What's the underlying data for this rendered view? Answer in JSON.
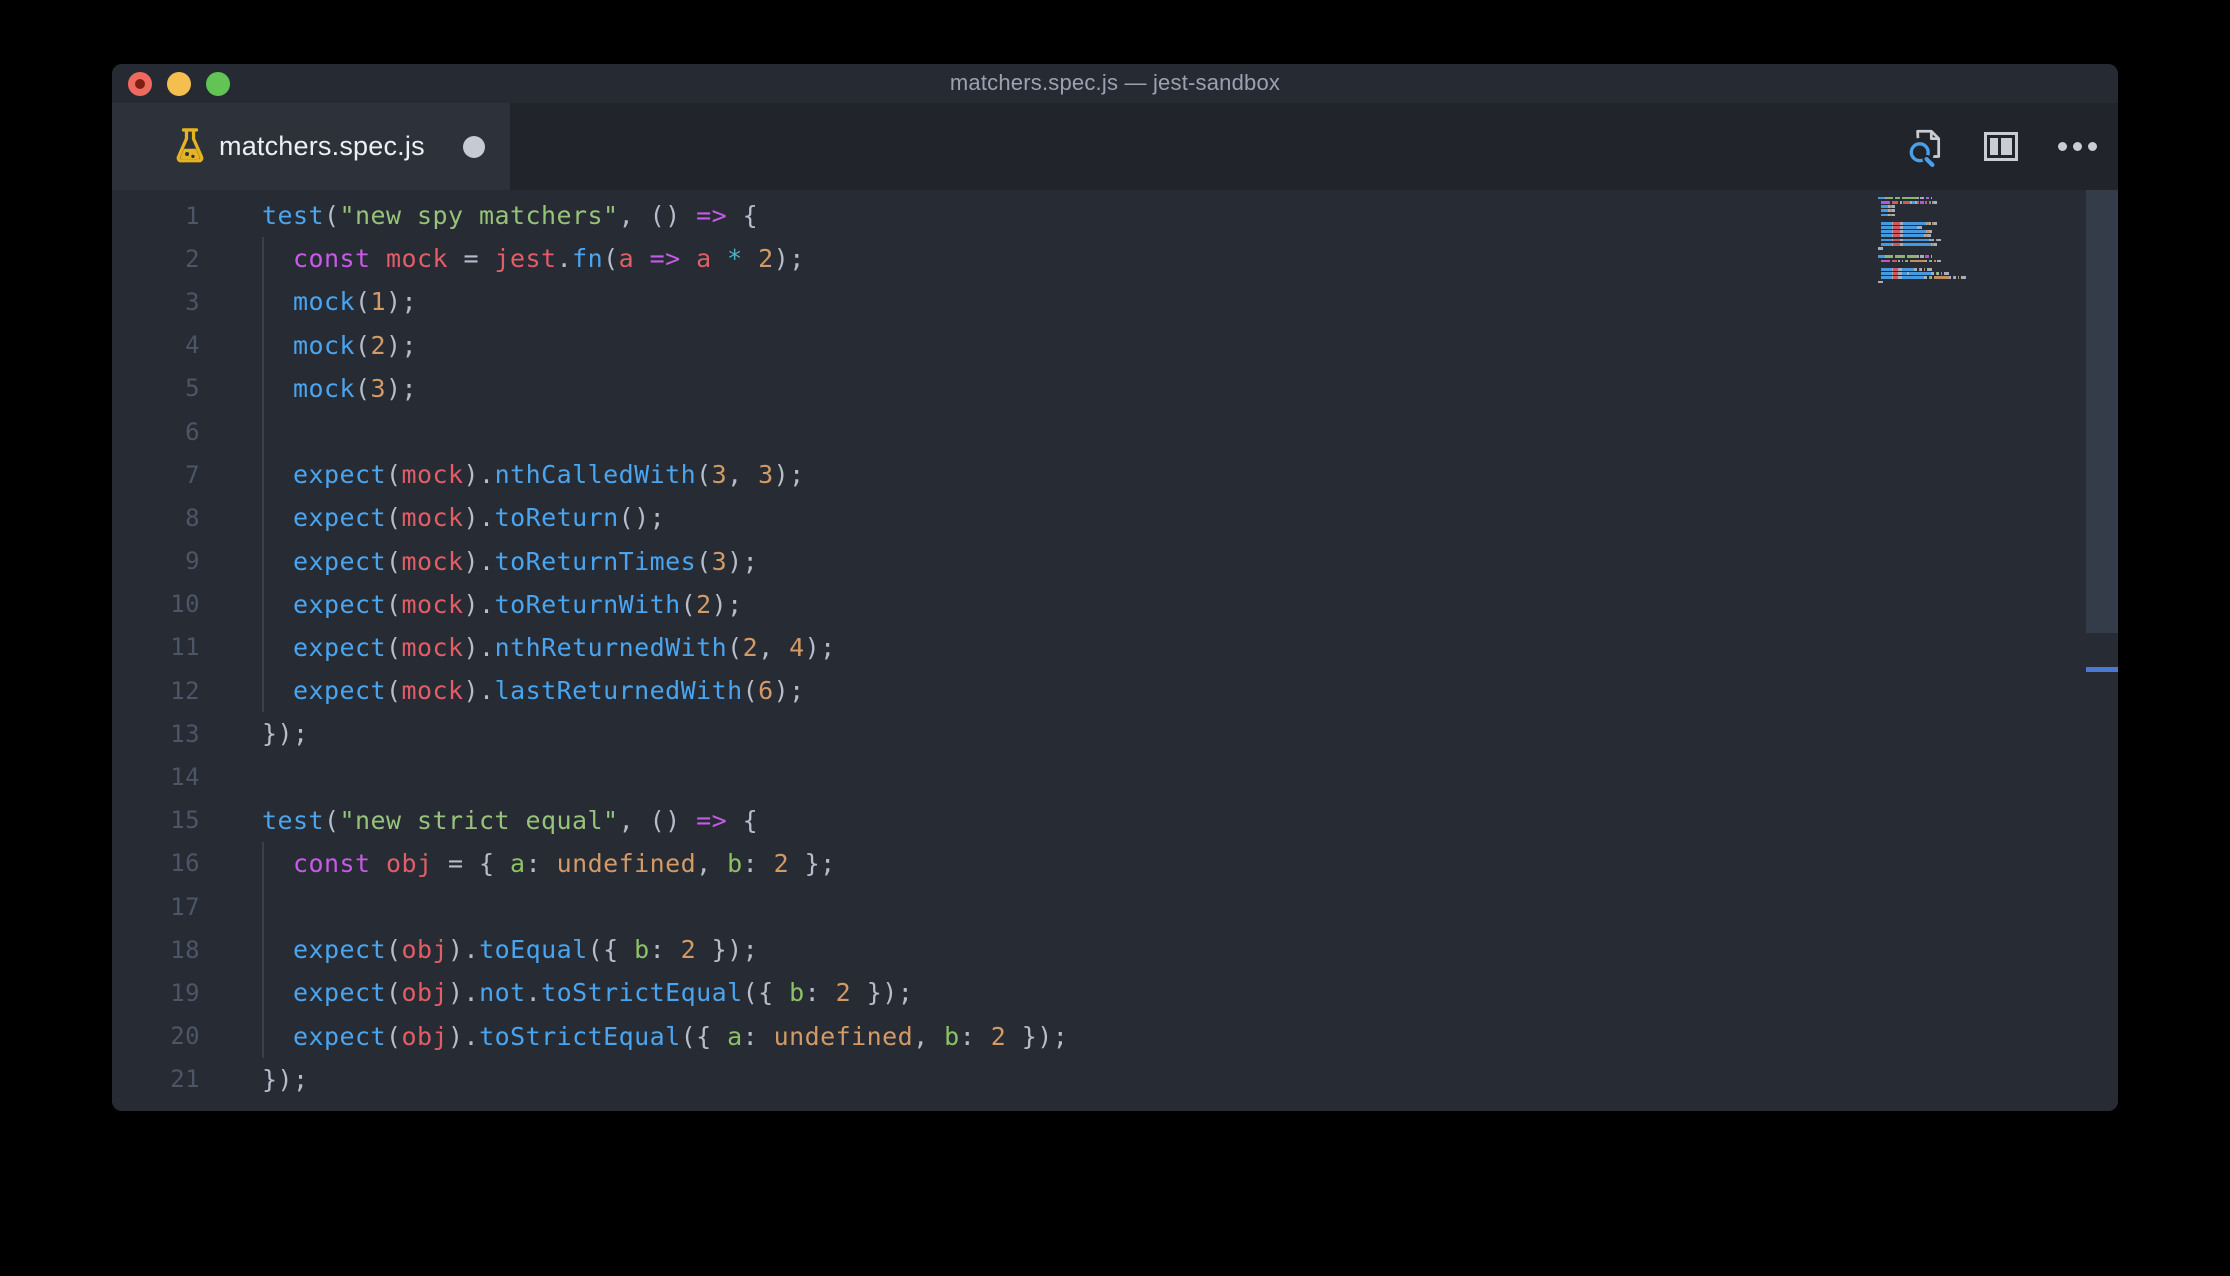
{
  "window": {
    "title": "matchers.spec.js — jest-sandbox"
  },
  "tab": {
    "label": "matchers.spec.js",
    "modified": true,
    "icon": "test-flask-icon"
  },
  "toolbar": {
    "icons": [
      "search-file-icon",
      "split-editor-icon",
      "more-actions-icon"
    ]
  },
  "colors": {
    "desktop": "#000000",
    "titlebar": "#262b33",
    "tabbar": "#21252b",
    "active_tab": "#2c313a",
    "editor_bg": "#272b33",
    "traffic_red": "#ee6a5f",
    "traffic_yellow": "#f5bf50",
    "traffic_green": "#61c455",
    "line_number": "#4d5666",
    "scroll_thumb": "#343b49",
    "overview_cursor": "#4b78d4",
    "icon_gray": "#c9ccd1",
    "icon_blue": "#4aa0e8",
    "flask_yellow": "#e6b322"
  },
  "editor": {
    "syntax": {
      "fn": "#4aa5f0",
      "kw": "#c75ae8",
      "s": "#97c279",
      "n": "#d19a66",
      "v": "#e25d67",
      "cy": "#4cb2c4",
      "p": "#b6bdca",
      "k": "#8cc265"
    },
    "lines": [
      {
        "n": 1,
        "i": 0,
        "g": false,
        "t": [
          [
            "fn",
            "test"
          ],
          [
            "p",
            "("
          ],
          [
            "s",
            "\"new spy matchers\""
          ],
          [
            "p",
            ", () "
          ],
          [
            "kw",
            "=>"
          ],
          [
            "p",
            " {"
          ]
        ]
      },
      {
        "n": 2,
        "i": 1,
        "g": true,
        "t": [
          [
            "kw",
            "const "
          ],
          [
            "v",
            "mock"
          ],
          [
            "p",
            " = "
          ],
          [
            "v",
            "jest"
          ],
          [
            "p",
            "."
          ],
          [
            "fn",
            "fn"
          ],
          [
            "p",
            "("
          ],
          [
            "v",
            "a"
          ],
          [
            "kw",
            " => "
          ],
          [
            "v",
            "a"
          ],
          [
            "cy",
            " * "
          ],
          [
            "n",
            "2"
          ],
          [
            "p",
            ");"
          ]
        ]
      },
      {
        "n": 3,
        "i": 1,
        "g": true,
        "t": [
          [
            "fn",
            "mock"
          ],
          [
            "p",
            "("
          ],
          [
            "n",
            "1"
          ],
          [
            "p",
            ");"
          ]
        ]
      },
      {
        "n": 4,
        "i": 1,
        "g": true,
        "t": [
          [
            "fn",
            "mock"
          ],
          [
            "p",
            "("
          ],
          [
            "n",
            "2"
          ],
          [
            "p",
            ");"
          ]
        ]
      },
      {
        "n": 5,
        "i": 1,
        "g": true,
        "t": [
          [
            "fn",
            "mock"
          ],
          [
            "p",
            "("
          ],
          [
            "n",
            "3"
          ],
          [
            "p",
            ");"
          ]
        ]
      },
      {
        "n": 6,
        "i": 0,
        "g": true,
        "t": []
      },
      {
        "n": 7,
        "i": 1,
        "g": true,
        "t": [
          [
            "fn",
            "expect"
          ],
          [
            "p",
            "("
          ],
          [
            "v",
            "mock"
          ],
          [
            "p",
            ")."
          ],
          [
            "fn",
            "nthCalledWith"
          ],
          [
            "p",
            "("
          ],
          [
            "n",
            "3"
          ],
          [
            "p",
            ", "
          ],
          [
            "n",
            "3"
          ],
          [
            "p",
            ");"
          ]
        ]
      },
      {
        "n": 8,
        "i": 1,
        "g": true,
        "t": [
          [
            "fn",
            "expect"
          ],
          [
            "p",
            "("
          ],
          [
            "v",
            "mock"
          ],
          [
            "p",
            ")."
          ],
          [
            "fn",
            "toReturn"
          ],
          [
            "p",
            "();"
          ]
        ]
      },
      {
        "n": 9,
        "i": 1,
        "g": true,
        "t": [
          [
            "fn",
            "expect"
          ],
          [
            "p",
            "("
          ],
          [
            "v",
            "mock"
          ],
          [
            "p",
            ")."
          ],
          [
            "fn",
            "toReturnTimes"
          ],
          [
            "p",
            "("
          ],
          [
            "n",
            "3"
          ],
          [
            "p",
            ");"
          ]
        ]
      },
      {
        "n": 10,
        "i": 1,
        "g": true,
        "t": [
          [
            "fn",
            "expect"
          ],
          [
            "p",
            "("
          ],
          [
            "v",
            "mock"
          ],
          [
            "p",
            ")."
          ],
          [
            "fn",
            "toReturnWith"
          ],
          [
            "p",
            "("
          ],
          [
            "n",
            "2"
          ],
          [
            "p",
            ");"
          ]
        ]
      },
      {
        "n": 11,
        "i": 1,
        "g": true,
        "t": [
          [
            "fn",
            "expect"
          ],
          [
            "p",
            "("
          ],
          [
            "v",
            "mock"
          ],
          [
            "p",
            ")."
          ],
          [
            "fn",
            "nthReturnedWith"
          ],
          [
            "p",
            "("
          ],
          [
            "n",
            "2"
          ],
          [
            "p",
            ", "
          ],
          [
            "n",
            "4"
          ],
          [
            "p",
            ");"
          ]
        ]
      },
      {
        "n": 12,
        "i": 1,
        "g": true,
        "t": [
          [
            "fn",
            "expect"
          ],
          [
            "p",
            "("
          ],
          [
            "v",
            "mock"
          ],
          [
            "p",
            ")."
          ],
          [
            "fn",
            "lastReturnedWith"
          ],
          [
            "p",
            "("
          ],
          [
            "n",
            "6"
          ],
          [
            "p",
            ");"
          ]
        ]
      },
      {
        "n": 13,
        "i": 0,
        "g": false,
        "t": [
          [
            "p",
            "});"
          ]
        ]
      },
      {
        "n": 14,
        "i": 0,
        "g": false,
        "t": []
      },
      {
        "n": 15,
        "i": 0,
        "g": false,
        "t": [
          [
            "fn",
            "test"
          ],
          [
            "p",
            "("
          ],
          [
            "s",
            "\"new strict equal\""
          ],
          [
            "p",
            ", () "
          ],
          [
            "kw",
            "=>"
          ],
          [
            "p",
            " {"
          ]
        ]
      },
      {
        "n": 16,
        "i": 1,
        "g": true,
        "t": [
          [
            "kw",
            "const "
          ],
          [
            "v",
            "obj"
          ],
          [
            "p",
            " = { "
          ],
          [
            "k",
            "a"
          ],
          [
            "p",
            ": "
          ],
          [
            "n",
            "undefined"
          ],
          [
            "p",
            ", "
          ],
          [
            "k",
            "b"
          ],
          [
            "p",
            ": "
          ],
          [
            "n",
            "2"
          ],
          [
            "p",
            " };"
          ]
        ]
      },
      {
        "n": 17,
        "i": 0,
        "g": true,
        "t": []
      },
      {
        "n": 18,
        "i": 1,
        "g": true,
        "t": [
          [
            "fn",
            "expect"
          ],
          [
            "p",
            "("
          ],
          [
            "v",
            "obj"
          ],
          [
            "p",
            ")."
          ],
          [
            "fn",
            "toEqual"
          ],
          [
            "p",
            "({ "
          ],
          [
            "k",
            "b"
          ],
          [
            "p",
            ": "
          ],
          [
            "n",
            "2"
          ],
          [
            "p",
            " });"
          ]
        ]
      },
      {
        "n": 19,
        "i": 1,
        "g": true,
        "t": [
          [
            "fn",
            "expect"
          ],
          [
            "p",
            "("
          ],
          [
            "v",
            "obj"
          ],
          [
            "p",
            ")."
          ],
          [
            "fn",
            "not"
          ],
          [
            "p",
            "."
          ],
          [
            "fn",
            "toStrictEqual"
          ],
          [
            "p",
            "({ "
          ],
          [
            "k",
            "b"
          ],
          [
            "p",
            ": "
          ],
          [
            "n",
            "2"
          ],
          [
            "p",
            " });"
          ]
        ]
      },
      {
        "n": 20,
        "i": 1,
        "g": true,
        "t": [
          [
            "fn",
            "expect"
          ],
          [
            "p",
            "("
          ],
          [
            "v",
            "obj"
          ],
          [
            "p",
            ")."
          ],
          [
            "fn",
            "toStrictEqual"
          ],
          [
            "p",
            "({ "
          ],
          [
            "k",
            "a"
          ],
          [
            "p",
            ": "
          ],
          [
            "n",
            "undefined"
          ],
          [
            "p",
            ", "
          ],
          [
            "k",
            "b"
          ],
          [
            "p",
            ": "
          ],
          [
            "n",
            "2"
          ],
          [
            "p",
            " });"
          ]
        ]
      },
      {
        "n": 21,
        "i": 0,
        "g": false,
        "t": [
          [
            "p",
            "});"
          ]
        ]
      }
    ]
  }
}
